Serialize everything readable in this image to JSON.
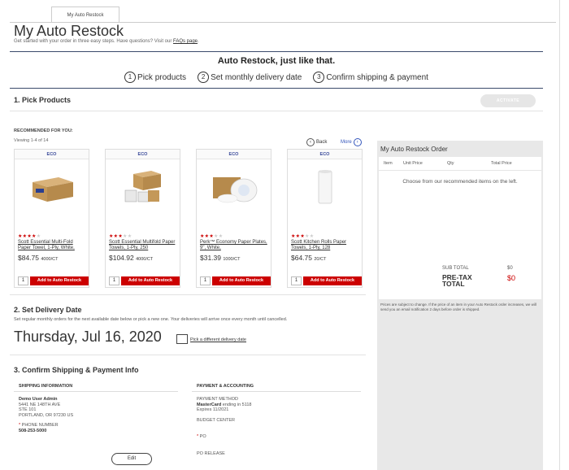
{
  "tab": {
    "label": "My Auto Restock"
  },
  "header": {
    "title": "My Auto Restock",
    "subtitle_prefix": "Get started with your order in three easy steps. Have questions? Visit our",
    "faq_link": "FAQs page",
    "subtitle_suffix": "."
  },
  "banner": {
    "title": "Auto Restock, just like that."
  },
  "steps": [
    {
      "num": "1",
      "label": "Pick products"
    },
    {
      "num": "2",
      "label": "Set monthly delivery date"
    },
    {
      "num": "3",
      "label": "Confirm shipping & payment"
    }
  ],
  "section1": {
    "title": "1. Pick Products",
    "activate_label": "ACTIVATE",
    "recommended_label": "RECOMMENDED FOR YOU:",
    "viewing": "Viewing 1-4 of 14",
    "back_label": "Back",
    "more_label": "More"
  },
  "products": [
    {
      "badge": "ECO",
      "rating": 4,
      "name": "Scott Essential Multi-Fold Paper Towel, 1-Ply, White,",
      "price": "$84.75",
      "unit": "4000/CT",
      "qty": "1",
      "add_label": "Add to Auto Restock"
    },
    {
      "badge": "ECO",
      "rating": 3,
      "name": "Scott Essential Multifold Paper Towels, 1-Ply, 250",
      "price": "$104.92",
      "unit": "4000/CT",
      "qty": "1",
      "add_label": "Add to Auto Restock"
    },
    {
      "badge": "ECO",
      "rating": 3,
      "name": "Perk™ Economy Paper Plates, 9\", White,",
      "price": "$31.39",
      "unit": "1000/CT",
      "qty": "1",
      "add_label": "Add to Auto Restock"
    },
    {
      "badge": "ECO",
      "rating": 3,
      "name": "Scott Kitchen Rolls Paper Towels, 1-Ply, 128",
      "price": "$64.75",
      "unit": "20/CT",
      "qty": "1",
      "add_label": "Add to Auto Restock"
    }
  ],
  "order": {
    "title": "My Auto Restock Order",
    "cols": [
      "Item",
      "Unit Price",
      "Qty",
      "Total Price"
    ],
    "empty_msg": "Choose from our recommended items on the left.",
    "subtotal_label": "SUB TOTAL",
    "subtotal_value": "$0",
    "pretax_label": "PRE-TAX TOTAL",
    "pretax_value": "$0",
    "note": "Prices are subject to change. If the price of an item in your Auto Restock order increases, we will send you an email notification 2 days before order is shipped."
  },
  "section2": {
    "title": "2. Set Delivery Date",
    "desc": "Set regular monthly orders for the next available date below or pick a new one. Your deliveries will arrive once every month until cancelled.",
    "date": "Thursday, Jul 16, 2020",
    "pick_link": "Pick a different delivery date"
  },
  "section3": {
    "title": "3. Confirm Shipping & Payment Info",
    "shipping_head": "SHIPPING INFORMATION",
    "ship_name": "Demo User Admin",
    "ship_line1": "5441 NE 148TH AVE",
    "ship_line2": "STE 101",
    "ship_line3": "PORTLAND, OR 97230 US",
    "phone_label": "PHONE NUMBER",
    "phone": "508-253-5000",
    "edit_label": "Edit",
    "payment_head": "PAYMENT & ACCOUNTING",
    "pay_method_label": "PAYMENT METHOD",
    "pay_card": "MasterCard",
    "pay_card_suffix": "ending in 5118",
    "pay_expires": "Expires 11/2021",
    "budget_center": "BUDGET CENTER",
    "po": "PO",
    "po_release": "PO RELEASE"
  },
  "colors": {
    "accent_red": "#cc0000",
    "eco_blue": "#3a4a9a",
    "header_line": "#3a4a6b"
  }
}
